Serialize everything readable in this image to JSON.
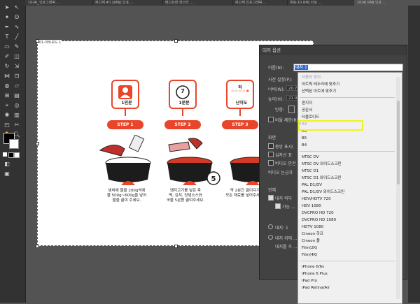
{
  "tabs": [
    "10(4)_인포그래픽 ...",
    "짜고재 #1 [RMJ] 인포 ...",
    "배고프면 파스타 ...",
    "짜고재 인포그래픽 ...",
    "재료-10 RMJ 인포 ...",
    "10(4) RMJ 인포 ..."
  ],
  "artboard": {
    "label": "01-아트보드 1",
    "cards": [
      {
        "label": "1인분",
        "icon": "person-icon"
      },
      {
        "label": "1분분",
        "icon": "clock-icon",
        "number": "7"
      },
      {
        "label": "난이도",
        "icon": "stars-icon",
        "top": "하",
        "stars": "☆☆☆☆★"
      }
    ],
    "steps": [
      "STEP 1",
      "STEP 2",
      "STEP 3"
    ],
    "step_badge": "5",
    "captions": [
      "냄비에 물을 200g씩에\n물 500g~600g을 넣어\n물을 끓여 주세요.",
      "돼지고기를 넣은 후\n떡, 김치, 양념소스와\n국물 5분쯤 끓여주세요.",
      "약 2분간 끓이다가\n모든 재료를 넣어주세요."
    ]
  },
  "dialog": {
    "title": "대지 옵션",
    "name_label": "이름(N):",
    "name_value": "대지 1",
    "preset_label": "사전 설정(P):",
    "width_label": "너비(W):",
    "width_value": "20.7",
    "height_label": "높이(H):",
    "height_value": "21.0",
    "orientation_label": "방향:",
    "ratio_label": "비율 제한(R)",
    "display_label": "화면",
    "show_center": "중앙 표시(",
    "show_crosshair": "십자선 표",
    "video_safe": "비디오 안전",
    "video_ruler": "비디오 눈금자",
    "global_label": "전체",
    "artboard_outside": "대지 외부",
    "fade_label": "가능 ...",
    "artboard_count": "대지: 1",
    "paragraph_left": "대지 위에 ...",
    "paragraph_right": "대지를 추 ..."
  },
  "dropdown": {
    "items": [
      {
        "label": "사용자 정의",
        "dim": true
      },
      {
        "label": "아트웍 테두리에 맞추기"
      },
      {
        "label": "선택된 아트에 맞추기"
      },
      {
        "sep": true
      },
      {
        "label": "편지지"
      },
      {
        "label": "공문서"
      },
      {
        "label": "타블로이드"
      },
      {
        "label": "A4",
        "dim": true,
        "checked": true
      },
      {
        "label": "A3"
      },
      {
        "label": "B5"
      },
      {
        "label": "B4"
      },
      {
        "sep": true
      },
      {
        "label": "NTSC DV"
      },
      {
        "label": "NTSC DV 와이드스크린"
      },
      {
        "label": "NTSC D1"
      },
      {
        "label": "NTSC D1 와이드스크린"
      },
      {
        "label": "PAL D1/DV"
      },
      {
        "label": "PAL D1/DV 와이드스크린"
      },
      {
        "label": "HDV/HDTV 720"
      },
      {
        "label": "HDV 1080"
      },
      {
        "label": "DVCPRO HD 720"
      },
      {
        "label": "DVCPRO HD 1080"
      },
      {
        "label": "HDTV 1080"
      },
      {
        "label": "Cineon 하프"
      },
      {
        "label": "Cineon 풀"
      },
      {
        "label": "Film(2K)"
      },
      {
        "label": "Film(4K)"
      },
      {
        "sep": true
      },
      {
        "label": "iPhone 6/6s"
      },
      {
        "label": "iPhone 6 Plus"
      },
      {
        "label": "iPad Pro"
      },
      {
        "label": "iPad Retina/Air"
      }
    ]
  },
  "colors": {
    "accent": "#e8452a",
    "highlight": "#f2f21c",
    "selection": "#2f6bd6"
  }
}
